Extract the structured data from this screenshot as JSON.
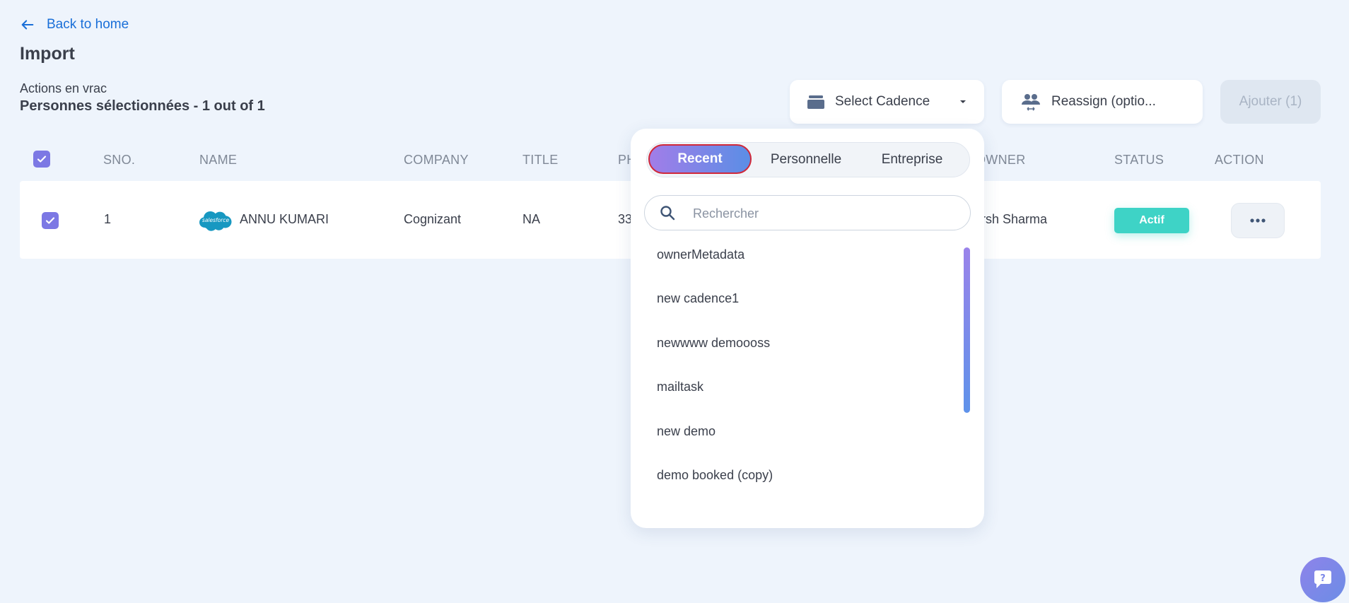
{
  "header": {
    "back_label": "Back to home",
    "title": "Import",
    "bulk_caption": "Actions en vrac",
    "selected_text": "Personnes sélectionnées - 1 out of 1"
  },
  "toolbar": {
    "select_cadence_label": "Select Cadence",
    "reassign_label": "Reassign (optio...",
    "add_label": "Ajouter (1)"
  },
  "table": {
    "columns": [
      "SNO.",
      "NAME",
      "COMPANY",
      "TITLE",
      "PH",
      "OWNER",
      "STATUS",
      "ACTION"
    ],
    "rows": [
      {
        "sno": "1",
        "source": "salesforce",
        "name": "ANNU KUMARI",
        "company": "Cognizant",
        "title": "NA",
        "phone": "33",
        "owner": "rsh Sharma",
        "status": "Actif"
      }
    ]
  },
  "dropdown": {
    "tabs": [
      "Recent",
      "Personnelle",
      "Entreprise"
    ],
    "active_tab": "Recent",
    "search_placeholder": "Rechercher",
    "items": [
      "ownerMetadata",
      "new cadence1",
      "newwww demoooss",
      "mailtask",
      "new demo",
      "demo booked (copy)"
    ]
  },
  "colors": {
    "background": "#eef4fc",
    "link": "#1a6fd8",
    "accent_purple": "#7c78e4",
    "status_active": "#3ed3c6",
    "active_tab_border": "#d0283a"
  },
  "icons": {
    "back": "arrow-left-icon",
    "cadence": "stack-icon",
    "reassign": "users-swap-icon",
    "search": "search-icon",
    "more": "more-horizontal-icon",
    "help": "chat-help-icon"
  }
}
